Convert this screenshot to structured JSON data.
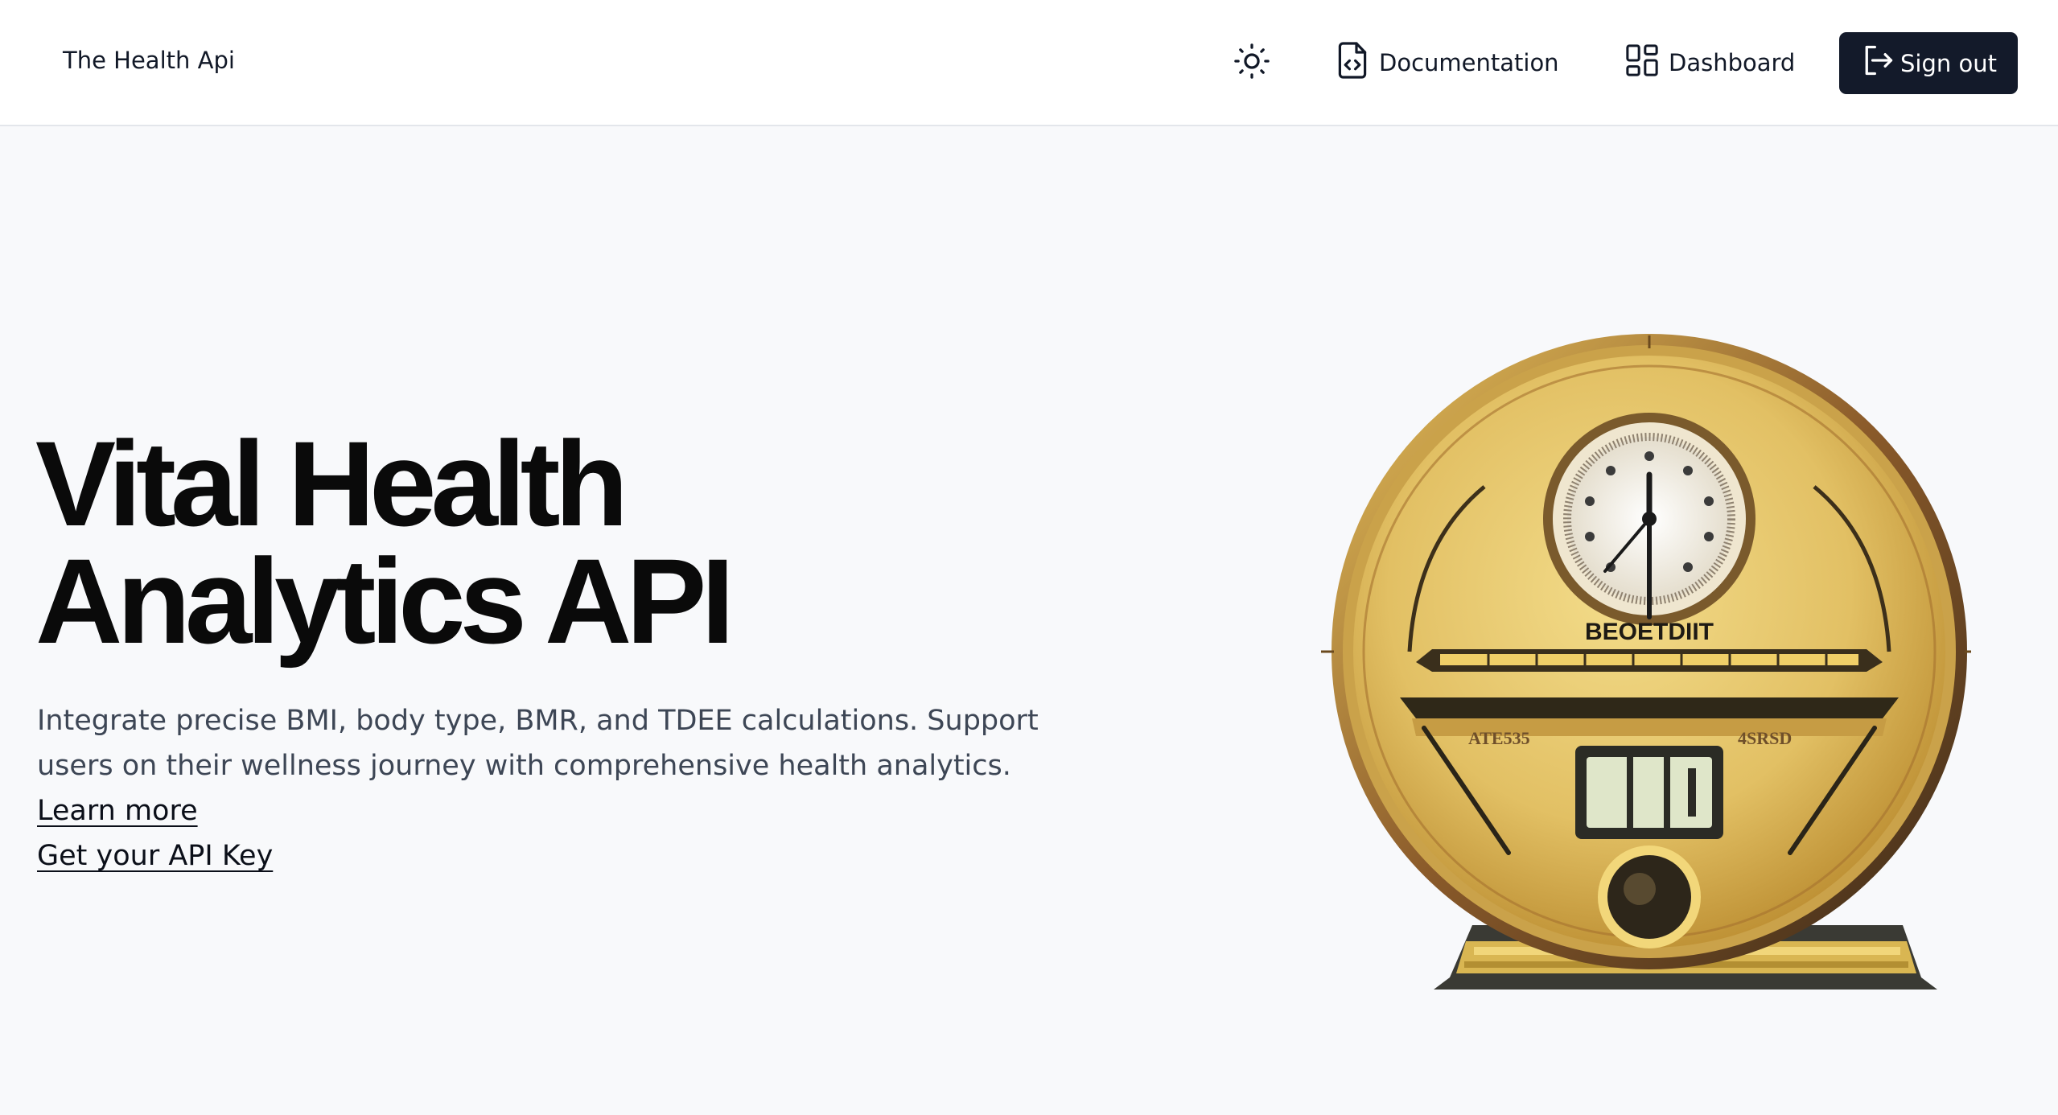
{
  "header": {
    "brand": "The Health Api",
    "nav": {
      "documentation": "Documentation",
      "dashboard": "Dashboard",
      "sign_out": "Sign out"
    },
    "icons": {
      "theme": "sun-icon",
      "documentation": "file-code-icon",
      "dashboard": "dashboard-grid-icon",
      "sign_out": "sign-out-icon"
    }
  },
  "hero": {
    "title_line1": "Vital Health",
    "title_line2": "Analytics API",
    "description": "Integrate precise BMI, body type, BMR, and TDEE calculations. Support users on their wellness journey with comprehensive health analytics.",
    "learn_more": "Learn more",
    "api_key_link": "Get your API Key",
    "image": {
      "subject": "golden-scale-clock-illustration",
      "plate_text": "BEOETDIIT",
      "left_text": "ATE535",
      "right_text": "4SRSD"
    }
  },
  "colors": {
    "page_bg": "#f8f9fb",
    "header_bg": "#ffffff",
    "primary_button": "#131a2a",
    "heading": "#0a0a0a",
    "body_text": "#3d4655",
    "gold": "#d8b44a"
  }
}
